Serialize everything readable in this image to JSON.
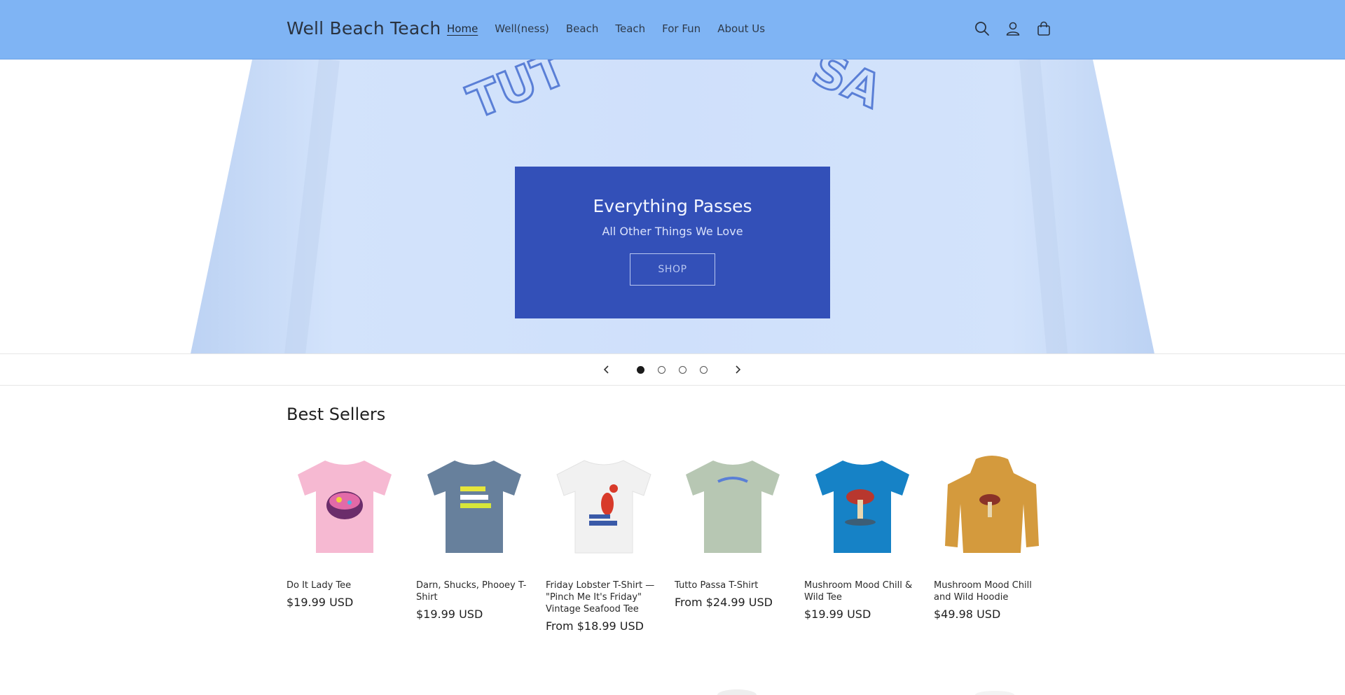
{
  "header": {
    "logo": "Well Beach Teach",
    "nav": [
      {
        "label": "Home",
        "active": true
      },
      {
        "label": "Well(ness)",
        "active": false
      },
      {
        "label": "Beach",
        "active": false
      },
      {
        "label": "Teach",
        "active": false
      },
      {
        "label": "For Fun",
        "active": false
      },
      {
        "label": "About Us",
        "active": false
      }
    ],
    "icons": [
      "search-icon",
      "account-icon",
      "cart-icon"
    ],
    "bg_color": "#7fb4f4"
  },
  "hero": {
    "shirt_text": "TUTTO PASSA",
    "title": "Everything Passes",
    "subtitle": "All Other Things We Love",
    "button_label": "SHOP",
    "box_color": "#3350b8",
    "slides_total": 4,
    "active_slide": 1
  },
  "best_sellers": {
    "title": "Best Sellers",
    "products": [
      {
        "name": "Do It Lady Tee",
        "price": "$19.99 USD",
        "color": "#f6b9d2"
      },
      {
        "name": "Darn, Shucks, Phooey T-Shirt",
        "price": "$19.99 USD",
        "color": "#67809c"
      },
      {
        "name": "Friday Lobster T-Shirt — \"Pinch Me It's Friday\" Vintage Seafood Tee",
        "price": "From $18.99 USD",
        "color": "#f1f1f1"
      },
      {
        "name": "Tutto Passa T-Shirt",
        "price": "From $24.99 USD",
        "color": "#b7c7b3"
      },
      {
        "name": "Mushroom Mood Chill & Wild Tee",
        "price": "$19.99 USD",
        "color": "#1682c6"
      },
      {
        "name": "Mushroom Mood Chill and Wild Hoodie",
        "price": "$49.98 USD",
        "color": "#d49a3d"
      }
    ]
  }
}
